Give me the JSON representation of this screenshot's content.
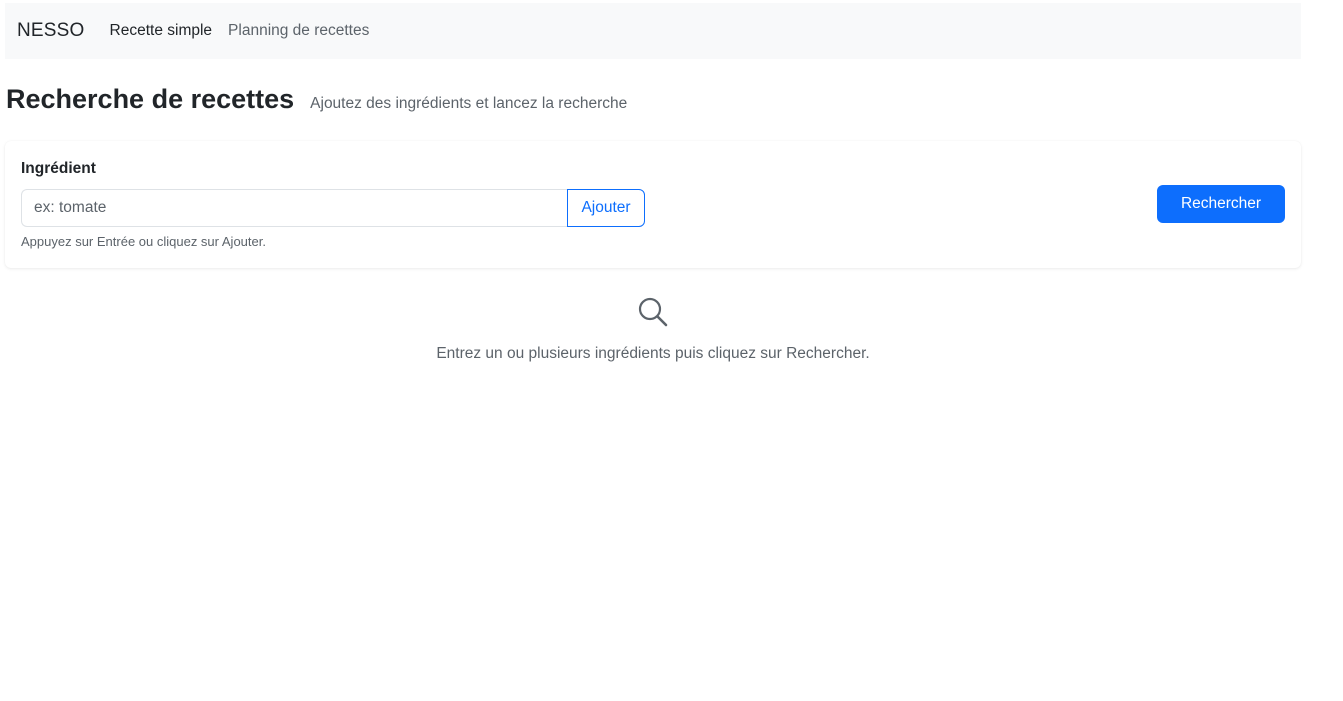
{
  "navbar": {
    "brand": "NESSO",
    "links": [
      {
        "label": "Recette simple",
        "active": true
      },
      {
        "label": "Planning de recettes",
        "active": false
      }
    ]
  },
  "header": {
    "title": "Recherche de recettes",
    "subtitle": "Ajoutez des ingrédients et lancez la recherche"
  },
  "form": {
    "ingredient_label": "Ingrédient",
    "input_placeholder": "ex: tomate",
    "input_value": "",
    "add_label": "Ajouter",
    "help_text": "Appuyez sur Entrée ou cliquez sur Ajouter.",
    "search_label": "Rechercher"
  },
  "empty_state": {
    "icon": "search-icon",
    "message": "Entrez un ou plusieurs ingrédients puis cliquez sur Rechercher."
  },
  "colors": {
    "primary": "#0d6efd",
    "navbar_bg": "#f8f9fa",
    "muted_text": "#5c636a"
  }
}
